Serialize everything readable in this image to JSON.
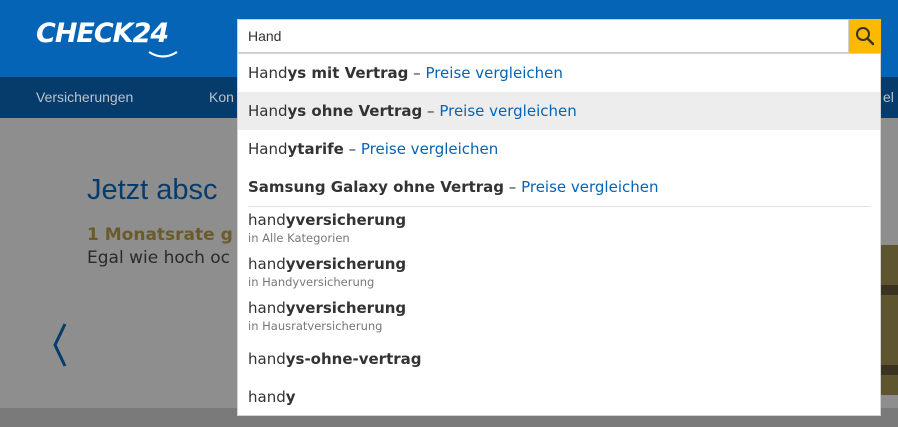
{
  "header": {
    "logo_text": "CHECK24",
    "brand_color": "#0564b6",
    "nav_items": [
      {
        "label": "Versicherungen"
      },
      {
        "label": "Kon"
      },
      {
        "label": "el"
      }
    ]
  },
  "search": {
    "value": "Hand",
    "button_icon": "search-icon",
    "button_color": "#fbb900"
  },
  "suggestions": [
    {
      "prefix": "Hand",
      "rest": "ys mit Vertrag",
      "sep": " – ",
      "cta": "Preise vergleichen",
      "highlighted": false
    },
    {
      "prefix": "Hand",
      "rest": "ys ohne Vertrag",
      "sep": " – ",
      "cta": "Preise vergleichen",
      "highlighted": true
    },
    {
      "prefix": "Hand",
      "rest": "ytarife",
      "sep": " – ",
      "cta": "Preise vergleichen",
      "highlighted": false
    },
    {
      "prefix": "",
      "rest": "Samsung Galaxy ohne Vertrag",
      "sep": " – ",
      "cta": "Preise vergleichen",
      "highlighted": false
    }
  ],
  "queries": [
    {
      "prefix": "hand",
      "rest": "yversicherung",
      "category": "in Alle Kategorien"
    },
    {
      "prefix": "hand",
      "rest": "yversicherung",
      "category": "in Handyversicherung"
    },
    {
      "prefix": "hand",
      "rest": "yversicherung",
      "category": "in Hausratversicherung"
    },
    {
      "prefix": "hand",
      "rest": "ys-ohne-vertrag",
      "category": ""
    },
    {
      "prefix": "hand",
      "rest": "y",
      "category": ""
    }
  ],
  "hero": {
    "title": "Jetzt absc",
    "subtitle": "1 Monatsrate g",
    "text": "Egal wie hoch oc"
  }
}
